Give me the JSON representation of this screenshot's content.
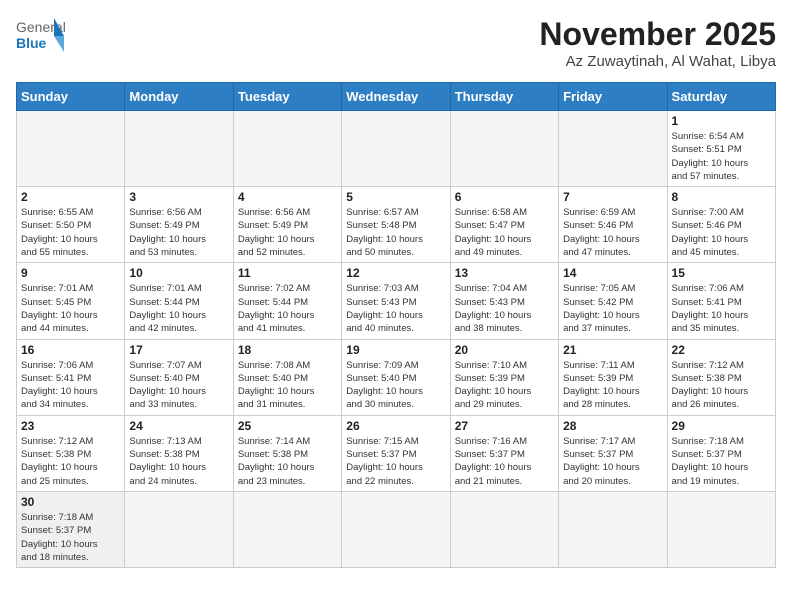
{
  "header": {
    "logo_general": "General",
    "logo_blue": "Blue",
    "month_title": "November 2025",
    "location": "Az Zuwaytinah, Al Wahat, Libya"
  },
  "weekdays": [
    "Sunday",
    "Monday",
    "Tuesday",
    "Wednesday",
    "Thursday",
    "Friday",
    "Saturday"
  ],
  "days": [
    {
      "date": "",
      "info": ""
    },
    {
      "date": "",
      "info": ""
    },
    {
      "date": "",
      "info": ""
    },
    {
      "date": "",
      "info": ""
    },
    {
      "date": "",
      "info": ""
    },
    {
      "date": "",
      "info": ""
    },
    {
      "date": "1",
      "info": "Sunrise: 6:54 AM\nSunset: 5:51 PM\nDaylight: 10 hours\nand 57 minutes."
    },
    {
      "date": "2",
      "info": "Sunrise: 6:55 AM\nSunset: 5:50 PM\nDaylight: 10 hours\nand 55 minutes."
    },
    {
      "date": "3",
      "info": "Sunrise: 6:56 AM\nSunset: 5:49 PM\nDaylight: 10 hours\nand 53 minutes."
    },
    {
      "date": "4",
      "info": "Sunrise: 6:56 AM\nSunset: 5:49 PM\nDaylight: 10 hours\nand 52 minutes."
    },
    {
      "date": "5",
      "info": "Sunrise: 6:57 AM\nSunset: 5:48 PM\nDaylight: 10 hours\nand 50 minutes."
    },
    {
      "date": "6",
      "info": "Sunrise: 6:58 AM\nSunset: 5:47 PM\nDaylight: 10 hours\nand 49 minutes."
    },
    {
      "date": "7",
      "info": "Sunrise: 6:59 AM\nSunset: 5:46 PM\nDaylight: 10 hours\nand 47 minutes."
    },
    {
      "date": "8",
      "info": "Sunrise: 7:00 AM\nSunset: 5:46 PM\nDaylight: 10 hours\nand 45 minutes."
    },
    {
      "date": "9",
      "info": "Sunrise: 7:01 AM\nSunset: 5:45 PM\nDaylight: 10 hours\nand 44 minutes."
    },
    {
      "date": "10",
      "info": "Sunrise: 7:01 AM\nSunset: 5:44 PM\nDaylight: 10 hours\nand 42 minutes."
    },
    {
      "date": "11",
      "info": "Sunrise: 7:02 AM\nSunset: 5:44 PM\nDaylight: 10 hours\nand 41 minutes."
    },
    {
      "date": "12",
      "info": "Sunrise: 7:03 AM\nSunset: 5:43 PM\nDaylight: 10 hours\nand 40 minutes."
    },
    {
      "date": "13",
      "info": "Sunrise: 7:04 AM\nSunset: 5:43 PM\nDaylight: 10 hours\nand 38 minutes."
    },
    {
      "date": "14",
      "info": "Sunrise: 7:05 AM\nSunset: 5:42 PM\nDaylight: 10 hours\nand 37 minutes."
    },
    {
      "date": "15",
      "info": "Sunrise: 7:06 AM\nSunset: 5:41 PM\nDaylight: 10 hours\nand 35 minutes."
    },
    {
      "date": "16",
      "info": "Sunrise: 7:06 AM\nSunset: 5:41 PM\nDaylight: 10 hours\nand 34 minutes."
    },
    {
      "date": "17",
      "info": "Sunrise: 7:07 AM\nSunset: 5:40 PM\nDaylight: 10 hours\nand 33 minutes."
    },
    {
      "date": "18",
      "info": "Sunrise: 7:08 AM\nSunset: 5:40 PM\nDaylight: 10 hours\nand 31 minutes."
    },
    {
      "date": "19",
      "info": "Sunrise: 7:09 AM\nSunset: 5:40 PM\nDaylight: 10 hours\nand 30 minutes."
    },
    {
      "date": "20",
      "info": "Sunrise: 7:10 AM\nSunset: 5:39 PM\nDaylight: 10 hours\nand 29 minutes."
    },
    {
      "date": "21",
      "info": "Sunrise: 7:11 AM\nSunset: 5:39 PM\nDaylight: 10 hours\nand 28 minutes."
    },
    {
      "date": "22",
      "info": "Sunrise: 7:12 AM\nSunset: 5:38 PM\nDaylight: 10 hours\nand 26 minutes."
    },
    {
      "date": "23",
      "info": "Sunrise: 7:12 AM\nSunset: 5:38 PM\nDaylight: 10 hours\nand 25 minutes."
    },
    {
      "date": "24",
      "info": "Sunrise: 7:13 AM\nSunset: 5:38 PM\nDaylight: 10 hours\nand 24 minutes."
    },
    {
      "date": "25",
      "info": "Sunrise: 7:14 AM\nSunset: 5:38 PM\nDaylight: 10 hours\nand 23 minutes."
    },
    {
      "date": "26",
      "info": "Sunrise: 7:15 AM\nSunset: 5:37 PM\nDaylight: 10 hours\nand 22 minutes."
    },
    {
      "date": "27",
      "info": "Sunrise: 7:16 AM\nSunset: 5:37 PM\nDaylight: 10 hours\nand 21 minutes."
    },
    {
      "date": "28",
      "info": "Sunrise: 7:17 AM\nSunset: 5:37 PM\nDaylight: 10 hours\nand 20 minutes."
    },
    {
      "date": "29",
      "info": "Sunrise: 7:18 AM\nSunset: 5:37 PM\nDaylight: 10 hours\nand 19 minutes."
    },
    {
      "date": "30",
      "info": "Sunrise: 7:18 AM\nSunset: 5:37 PM\nDaylight: 10 hours\nand 18 minutes."
    }
  ]
}
